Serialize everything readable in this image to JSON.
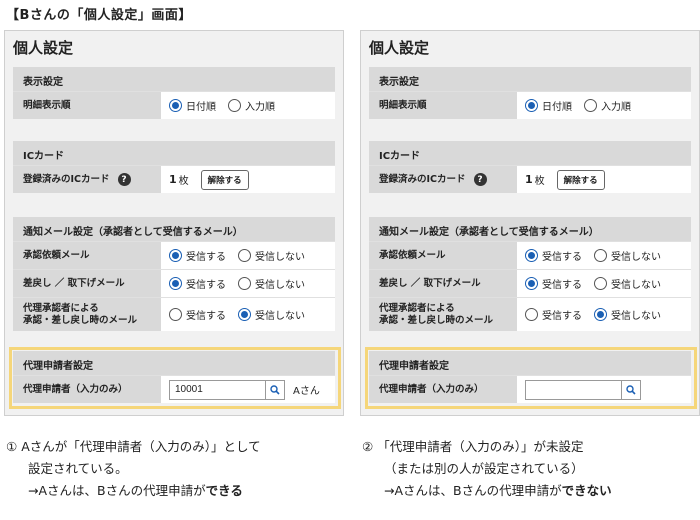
{
  "heading": "【Bさんの「個人設定」画面】",
  "panels": [
    {
      "title": "個人設定",
      "display": {
        "section": "表示設定",
        "row_label": "明細表示順",
        "opt1": "日付順",
        "opt2": "入力順"
      },
      "ic": {
        "section": "ICカード",
        "row_label": "登録済みのICカード",
        "help": "?",
        "count": "1",
        "count_unit": "枚",
        "release": "解除する"
      },
      "mail": {
        "section": "通知メール設定（承認者として受信するメール）",
        "row1_label": "承認依頼メール",
        "row2_label": "差戻し ／ 取下げメール",
        "row3_label_line1": "代理承認者による",
        "row3_label_line2": "承認・差し戻し時のメール",
        "receive": "受信する",
        "not_receive": "受信しない"
      },
      "proxy": {
        "section": "代理申請者設定",
        "row_label": "代理申請者（入力のみ）",
        "input_value": "10001",
        "name": "Aさん"
      }
    },
    {
      "title": "個人設定",
      "display": {
        "section": "表示設定",
        "row_label": "明細表示順",
        "opt1": "日付順",
        "opt2": "入力順"
      },
      "ic": {
        "section": "ICカード",
        "row_label": "登録済みのICカード",
        "help": "?",
        "count": "1",
        "count_unit": "枚",
        "release": "解除する"
      },
      "mail": {
        "section": "通知メール設定（承認者として受信するメール）",
        "row1_label": "承認依頼メール",
        "row2_label": "差戻し ／ 取下げメール",
        "row3_label_line1": "代理承認者による",
        "row3_label_line2": "承認・差し戻し時のメール",
        "receive": "受信する",
        "not_receive": "受信しない"
      },
      "proxy": {
        "section": "代理申請者設定",
        "row_label": "代理申請者（入力のみ）",
        "input_value": "",
        "name": ""
      }
    }
  ],
  "captions": {
    "left": {
      "num": "①",
      "line1": "Aさんが「代理申請者（入力のみ）」として",
      "line2": "設定されている。",
      "line3_prefix": "→Aさんは、Bさんの代理申請が",
      "line3_bold": "できる"
    },
    "right": {
      "num": "②",
      "line1": "「代理申請者（入力のみ）」が未設定",
      "line2": "（または別の人が設定されている）",
      "line3_prefix": "→Aさんは、Bさんの代理申請が",
      "line3_bold": "できない"
    }
  },
  "colors": {
    "radio_selected": "#1a5fb4",
    "highlight_border": "#f5d67a",
    "section_gray": "#d9d9d9",
    "panel_bg": "#f1f1f1"
  },
  "icons": {
    "search": "search-icon",
    "help": "help-icon"
  }
}
